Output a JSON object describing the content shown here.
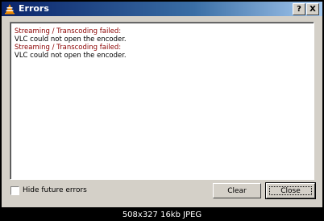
{
  "window": {
    "title": "Errors",
    "help_label": "?",
    "close_label": "X"
  },
  "log": {
    "entries": [
      {
        "heading": "Streaming / Transcoding failed:",
        "message": "VLC could not open the encoder."
      },
      {
        "heading": "Streaming / Transcoding failed:",
        "message": "VLC could not open the encoder."
      }
    ]
  },
  "options": {
    "hide_future_errors_label": "Hide future errors",
    "hide_future_errors_checked": false
  },
  "buttons": {
    "clear_label": "Clear",
    "close_label": "Close"
  },
  "caption": "508x327  16kb  JPEG",
  "colors": {
    "error_heading": "#8b0000",
    "titlebar_start": "#0a246a",
    "titlebar_end": "#a6caf0"
  },
  "icons": {
    "app": "vlc-cone-icon",
    "help": "question-mark-icon",
    "close": "close-x-icon"
  }
}
